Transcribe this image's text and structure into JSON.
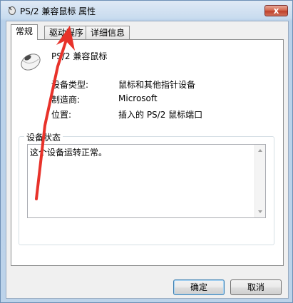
{
  "window": {
    "title": "PS/2 兼容鼠标 属性",
    "close_label": "x"
  },
  "tabs": [
    {
      "label": "常规",
      "active": true
    },
    {
      "label": "驱动程序",
      "active": false
    },
    {
      "label": "详细信息",
      "active": false
    }
  ],
  "device": {
    "name": "PS/2 兼容鼠标",
    "icon": "mouse-icon"
  },
  "properties": [
    {
      "label": "设备类型:",
      "value": "鼠标和其他指针设备"
    },
    {
      "label": "制造商:",
      "value": "Microsoft"
    },
    {
      "label": "位置:",
      "value": "插入的 PS/2 鼠标端口"
    }
  ],
  "status": {
    "legend": "设备状态",
    "text": "这个设备运转正常。"
  },
  "buttons": {
    "ok": "确定",
    "cancel": "取消"
  },
  "annotation": {
    "color": "#e8322a"
  }
}
